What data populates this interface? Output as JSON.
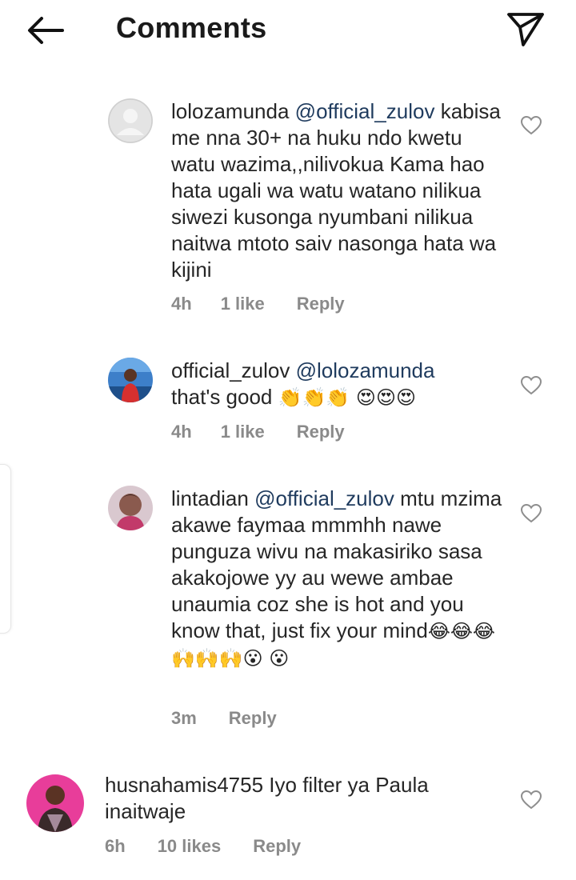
{
  "header": {
    "title": "Comments"
  },
  "comments": [
    {
      "username": "lolozamunda",
      "mention": "@official_zulov",
      "text": "kabisa me nna 30+ na huku ndo kwetu watu wazima,,nilivokua Kama hao hata ugali wa watu watano nilikua siwezi kusonga nyumbani nilikua naitwa mtoto saiv nasonga hata wa kijini",
      "time": "4h",
      "likes": "1 like",
      "reply": "Reply"
    },
    {
      "username": "official_zulov",
      "mention": "@lolozamunda",
      "text": "that's good",
      "emoji": "👏👏👏 😍😍😍",
      "time": "4h",
      "likes": "1 like",
      "reply": "Reply"
    },
    {
      "username": "lintadian",
      "mention": "@official_zulov",
      "text": "mtu mzima akawe faymaa mmmhh nawe punguza wivu na makasiriko sasa akakojowe yy au wewe ambae unaumia coz she is hot and you know that, just fix your mind",
      "emoji": "😂😂😂🙌🙌🙌😮 😮",
      "time": "3m",
      "reply": "Reply"
    },
    {
      "username": "husnahamis4755",
      "text": "Iyo filter ya Paula inaitwaje",
      "time": "6h",
      "likes": "10 likes",
      "reply": "Reply"
    }
  ],
  "icons": {
    "back": "arrow-left-icon",
    "share": "paper-plane-icon",
    "like": "heart-outline-icon"
  },
  "colors": {
    "mention": "#1f3b5e",
    "meta": "#8a8a8a",
    "text": "#262626"
  }
}
